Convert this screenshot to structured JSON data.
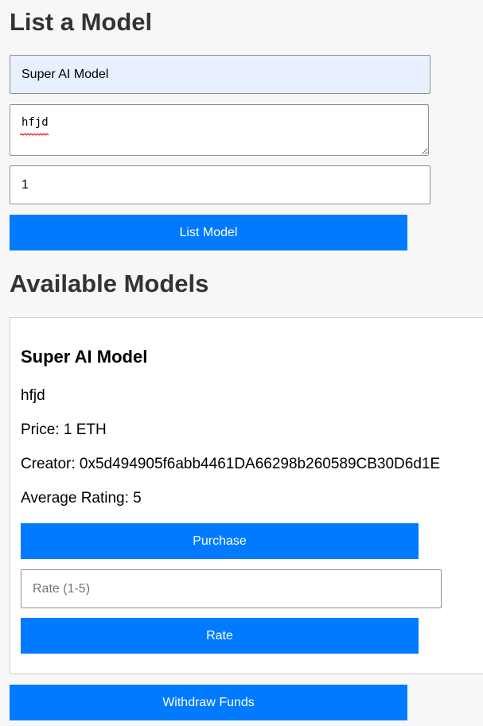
{
  "list_section": {
    "heading": "List a Model",
    "name_value": "Super AI Model",
    "description_value": "hfjd",
    "price_value": "1",
    "submit_label": "List Model"
  },
  "available_section": {
    "heading": "Available Models",
    "models": [
      {
        "name": "Super AI Model",
        "description": "hfjd",
        "price": "Price: 1 ETH",
        "creator": "Creator: 0x5d494905f6abb4461DA66298b260589CB30D6d1E",
        "rating": "Average Rating: 5",
        "purchase_label": "Purchase",
        "rate_placeholder": "Rate (1-5)",
        "rate_label": "Rate"
      }
    ]
  },
  "withdraw_label": "Withdraw Funds",
  "colors": {
    "accent": "#007bff",
    "autofill": "#e8f0fe",
    "page_bg": "#f7f7f7"
  }
}
